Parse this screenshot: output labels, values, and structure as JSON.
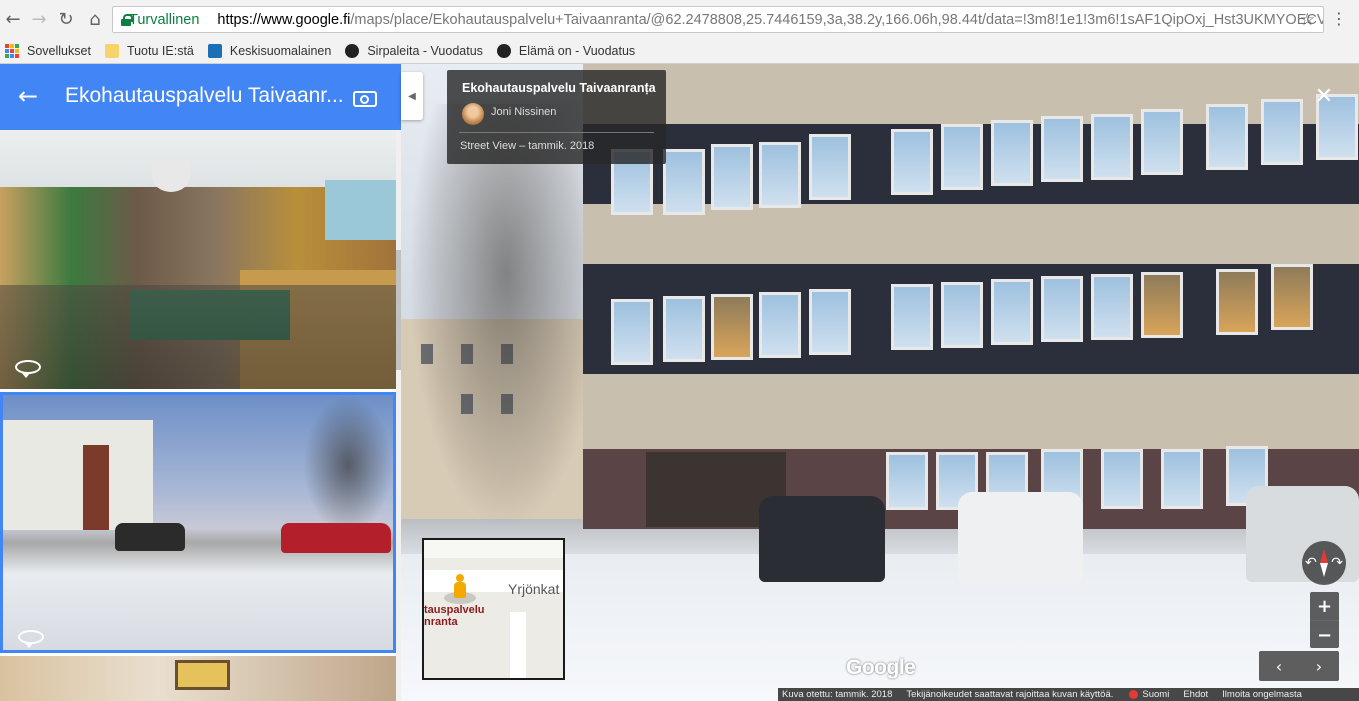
{
  "browser": {
    "secure_label": "Turvallinen",
    "url_domain": "https://www.google.fi",
    "url_path": "/maps/place/Ekohautauspalvelu+Taivaanranta/@62.2478808,25.7446159,3a,38.2y,166.06h,98.44t/data=!3m8!1e1!3m6!1sAF1QipOxj_Hst3UKMYOECVu...",
    "back_icon": "←",
    "forward_icon": "→",
    "reload_icon": "↻",
    "home_icon": "⌂",
    "star_icon": "☆",
    "menu_icon": "⋮"
  },
  "bookmarks": [
    {
      "label": "Sovellukset",
      "icon": "apps-icon"
    },
    {
      "label": "Tuotu IE:stä",
      "icon": "folder-icon"
    },
    {
      "label": "Keskisuomalainen",
      "icon": "site-icon"
    },
    {
      "label": "Sirpaleita - Vuodatus",
      "icon": "mask-icon"
    },
    {
      "label": "Elämä on - Vuodatus",
      "icon": "mask-icon"
    }
  ],
  "panel": {
    "title": "Ekohautauspalvelu Taivaanr...",
    "back_icon": "←"
  },
  "infocard": {
    "title": "Ekohautauspalvelu Taivaanranta",
    "author": "Joni Nissinen",
    "date": "Street View – tammik. 2018",
    "menu_icon": "⋮"
  },
  "controls": {
    "close": "✕",
    "collapse": "◀",
    "zoom_in": "+",
    "zoom_out": "−",
    "pan_left": "‹",
    "pan_right": "›"
  },
  "minimap": {
    "street": "Yrjönkat",
    "place_line1": "tauspalvelu",
    "place_line2": "nranta"
  },
  "logo": "Google",
  "footer": {
    "captured": "Kuva otettu: tammik. 2018",
    "copyright": "Tekijänoikeudet saattavat rajoittaa kuvan käyttöä.",
    "language": "Suomi",
    "terms": "Ehdot",
    "report": "Ilmoita ongelmasta"
  },
  "colors": {
    "header_blue": "#4285f4",
    "secure_green": "#0b8043"
  }
}
